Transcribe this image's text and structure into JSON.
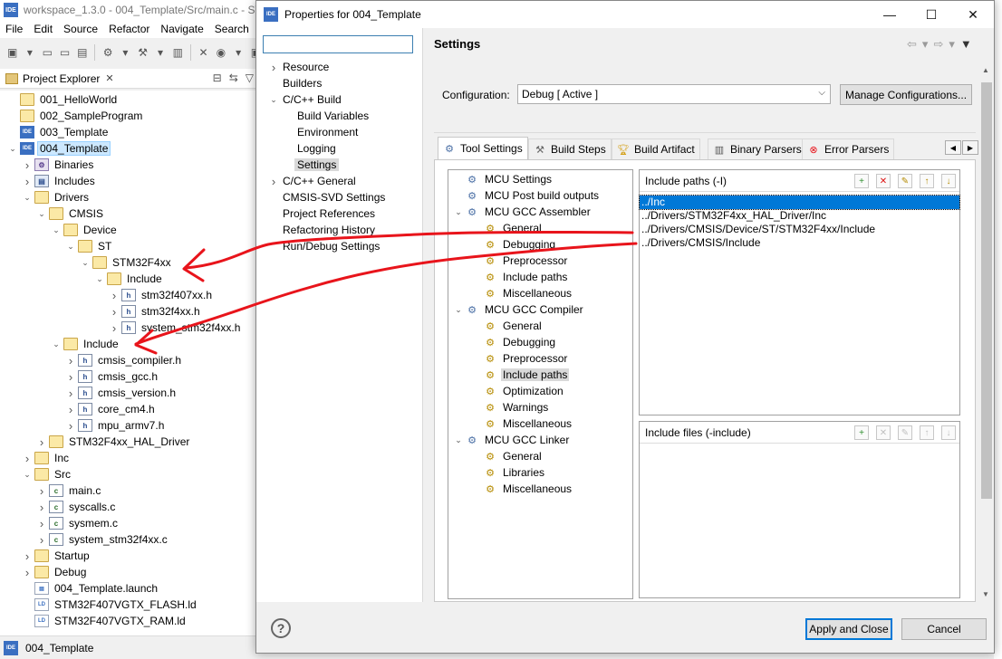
{
  "ide": {
    "logo_text": "IDE",
    "title": "workspace_1.3.0 - 004_Template/Src/main.c - STM",
    "menu": [
      "File",
      "Edit",
      "Source",
      "Refactor",
      "Navigate",
      "Search"
    ],
    "project_explorer_title": "Project Explorer",
    "status_project": "004_Template",
    "tree": [
      {
        "label": "001_HelloWorld",
        "icon": "folder",
        "twisty": ""
      },
      {
        "label": "002_SampleProgram",
        "icon": "folder",
        "twisty": ""
      },
      {
        "label": "003_Template",
        "icon": "ide-project",
        "twisty": ""
      },
      {
        "label": "004_Template",
        "icon": "ide-project",
        "twisty": "expanded",
        "selected": true
      },
      {
        "label": "Binaries",
        "icon": "binaries",
        "twisty": "collapsed"
      },
      {
        "label": "Includes",
        "icon": "includes",
        "twisty": "collapsed"
      },
      {
        "label": "Drivers",
        "icon": "folder",
        "twisty": "expanded"
      },
      {
        "label": "CMSIS",
        "icon": "folder",
        "twisty": "expanded"
      },
      {
        "label": "Device",
        "icon": "folder",
        "twisty": "expanded"
      },
      {
        "label": "ST",
        "icon": "folder",
        "twisty": "expanded"
      },
      {
        "label": "STM32F4xx",
        "icon": "folder",
        "twisty": "expanded"
      },
      {
        "label": "Include",
        "icon": "folder",
        "twisty": "expanded"
      },
      {
        "label": "stm32f407xx.h",
        "icon": "file-h",
        "twisty": "collapsed"
      },
      {
        "label": "stm32f4xx.h",
        "icon": "file-h",
        "twisty": "collapsed"
      },
      {
        "label": "system_stm32f4xx.h",
        "icon": "file-h",
        "twisty": "collapsed"
      },
      {
        "label": "Include",
        "icon": "folder",
        "twisty": "expanded"
      },
      {
        "label": "cmsis_compiler.h",
        "icon": "file-h",
        "twisty": "collapsed"
      },
      {
        "label": "cmsis_gcc.h",
        "icon": "file-h",
        "twisty": "collapsed"
      },
      {
        "label": "cmsis_version.h",
        "icon": "file-h",
        "twisty": "collapsed"
      },
      {
        "label": "core_cm4.h",
        "icon": "file-h",
        "twisty": "collapsed"
      },
      {
        "label": "mpu_armv7.h",
        "icon": "file-h",
        "twisty": "collapsed"
      },
      {
        "label": "STM32F4xx_HAL_Driver",
        "icon": "folder",
        "twisty": "collapsed"
      },
      {
        "label": "Inc",
        "icon": "folder",
        "twisty": "collapsed"
      },
      {
        "label": "Src",
        "icon": "folder",
        "twisty": "expanded"
      },
      {
        "label": "main.c",
        "icon": "file-c",
        "twisty": "collapsed"
      },
      {
        "label": "syscalls.c",
        "icon": "file-c",
        "twisty": "collapsed"
      },
      {
        "label": "sysmem.c",
        "icon": "file-c",
        "twisty": "collapsed"
      },
      {
        "label": "system_stm32f4xx.c",
        "icon": "file-c",
        "twisty": "collapsed"
      },
      {
        "label": "Startup",
        "icon": "folder",
        "twisty": "collapsed"
      },
      {
        "label": "Debug",
        "icon": "folder",
        "twisty": "collapsed"
      },
      {
        "label": "004_Template.launch",
        "icon": "file-launch",
        "twisty": ""
      },
      {
        "label": "STM32F407VGTX_FLASH.ld",
        "icon": "file-ld",
        "twisty": ""
      },
      {
        "label": "STM32F407VGTX_RAM.ld",
        "icon": "file-ld",
        "twisty": ""
      }
    ]
  },
  "dialog": {
    "logo_text": "IDE",
    "title": "Properties for 004_Template",
    "filter_value": "",
    "nav": [
      {
        "label": "Resource",
        "twisty": "collapsed",
        "indent": 0
      },
      {
        "label": "Builders",
        "twisty": "",
        "indent": 0
      },
      {
        "label": "C/C++ Build",
        "twisty": "expanded",
        "indent": 0
      },
      {
        "label": "Build Variables",
        "twisty": "",
        "indent": 1
      },
      {
        "label": "Environment",
        "twisty": "",
        "indent": 1
      },
      {
        "label": "Logging",
        "twisty": "",
        "indent": 1
      },
      {
        "label": "Settings",
        "twisty": "",
        "indent": 1,
        "selected": true
      },
      {
        "label": "C/C++ General",
        "twisty": "collapsed",
        "indent": 0
      },
      {
        "label": "CMSIS-SVD Settings",
        "twisty": "",
        "indent": 0
      },
      {
        "label": "Project References",
        "twisty": "",
        "indent": 0
      },
      {
        "label": "Refactoring History",
        "twisty": "",
        "indent": 0
      },
      {
        "label": "Run/Debug Settings",
        "twisty": "",
        "indent": 0
      }
    ],
    "page_title": "Settings",
    "configuration_label": "Configuration:",
    "configuration_value": "Debug  [ Active ]",
    "manage_button": "Manage Configurations...",
    "tabs": [
      {
        "label": "Tool Settings",
        "icon": "tool-settings-icon",
        "active": true
      },
      {
        "label": "Build Steps",
        "icon": "build-steps-icon"
      },
      {
        "label": "Build Artifact",
        "icon": "build-artifact-icon"
      },
      {
        "label": "Binary Parsers",
        "icon": "binary-parsers-icon"
      },
      {
        "label": "Error Parsers",
        "icon": "error-parsers-icon"
      }
    ],
    "options_tree": [
      {
        "label": "MCU Settings",
        "twisty": "",
        "indent": 0
      },
      {
        "label": "MCU Post build outputs",
        "twisty": "",
        "indent": 0
      },
      {
        "label": "MCU GCC Assembler",
        "twisty": "expanded",
        "indent": 0
      },
      {
        "label": "General",
        "twisty": "",
        "indent": 1
      },
      {
        "label": "Debugging",
        "twisty": "",
        "indent": 1
      },
      {
        "label": "Preprocessor",
        "twisty": "",
        "indent": 1
      },
      {
        "label": "Include paths",
        "twisty": "",
        "indent": 1
      },
      {
        "label": "Miscellaneous",
        "twisty": "",
        "indent": 1
      },
      {
        "label": "MCU GCC Compiler",
        "twisty": "expanded",
        "indent": 0
      },
      {
        "label": "General",
        "twisty": "",
        "indent": 1
      },
      {
        "label": "Debugging",
        "twisty": "",
        "indent": 1
      },
      {
        "label": "Preprocessor",
        "twisty": "",
        "indent": 1
      },
      {
        "label": "Include paths",
        "twisty": "",
        "indent": 1,
        "selected": true
      },
      {
        "label": "Optimization",
        "twisty": "",
        "indent": 1
      },
      {
        "label": "Warnings",
        "twisty": "",
        "indent": 1
      },
      {
        "label": "Miscellaneous",
        "twisty": "",
        "indent": 1
      },
      {
        "label": "MCU GCC Linker",
        "twisty": "expanded",
        "indent": 0
      },
      {
        "label": "General",
        "twisty": "",
        "indent": 1
      },
      {
        "label": "Libraries",
        "twisty": "",
        "indent": 1
      },
      {
        "label": "Miscellaneous",
        "twisty": "",
        "indent": 1
      }
    ],
    "include_paths_title": "Include paths (-I)",
    "include_paths": [
      "../Inc",
      "../Drivers/STM32F4xx_HAL_Driver/Inc",
      "../Drivers/CMSIS/Device/ST/STM32F4xx/Include",
      "../Drivers/CMSIS/Include"
    ],
    "include_files_title": "Include files (-include)",
    "help_symbol": "?",
    "apply_close_button": "Apply and Close",
    "cancel_button": "Cancel"
  },
  "colors": {
    "selection_blue": "#0078d7",
    "annotation_red": "#e8141b"
  }
}
